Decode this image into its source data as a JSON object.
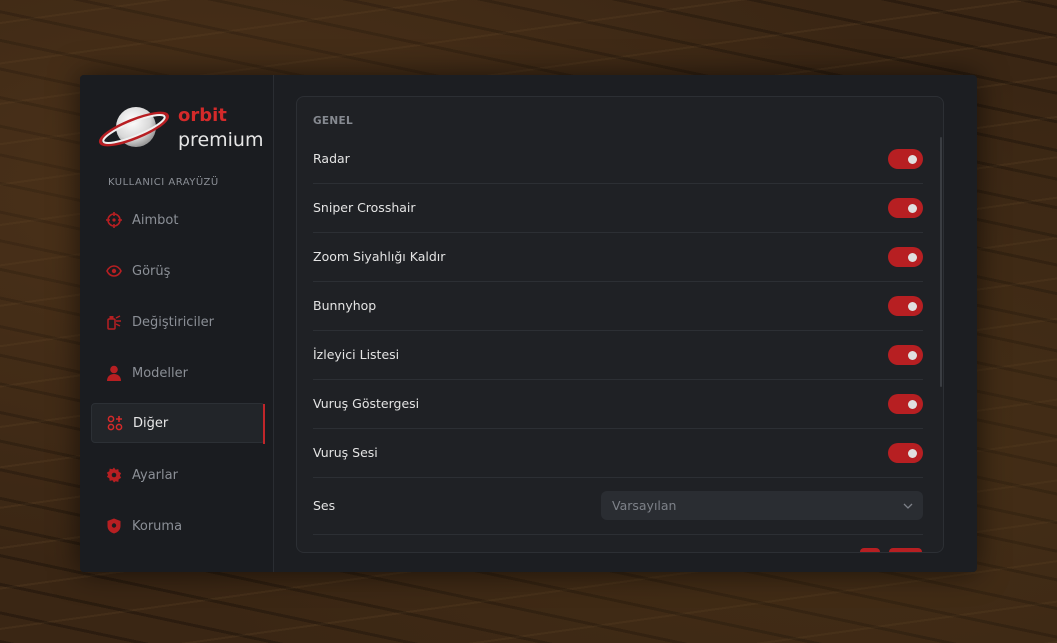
{
  "brand": {
    "name": "orbit",
    "tagline": "premium"
  },
  "sidebar": {
    "section_label": "KULLANICI ARAYÜZÜ",
    "items": [
      {
        "label": "Aimbot",
        "icon": "crosshair-icon",
        "active": false
      },
      {
        "label": "Görüş",
        "icon": "eye-icon",
        "active": false
      },
      {
        "label": "Değiştiriciler",
        "icon": "spray-icon",
        "active": false
      },
      {
        "label": "Modeller",
        "icon": "user-icon",
        "active": false
      },
      {
        "label": "Diğer",
        "icon": "grid-icon",
        "active": true
      },
      {
        "label": "Ayarlar",
        "icon": "gear-icon",
        "active": false
      },
      {
        "label": "Koruma",
        "icon": "shield-icon",
        "active": false
      }
    ]
  },
  "panel": {
    "title": "GENEL",
    "toggles": [
      {
        "label": "Radar",
        "on": true
      },
      {
        "label": "Sniper Crosshair",
        "on": true
      },
      {
        "label": "Zoom Siyahlığı Kaldır",
        "on": true
      },
      {
        "label": "Bunnyhop",
        "on": true
      },
      {
        "label": "İzleyici Listesi",
        "on": true
      },
      {
        "label": "Vuruş Göstergesi",
        "on": true
      },
      {
        "label": "Vuruş Sesi",
        "on": true
      }
    ],
    "sound": {
      "label": "Ses",
      "value": "Varsayılan"
    }
  },
  "colors": {
    "accent": "#c0262a",
    "background": "#1c1e22",
    "panel": "#1f2125"
  }
}
